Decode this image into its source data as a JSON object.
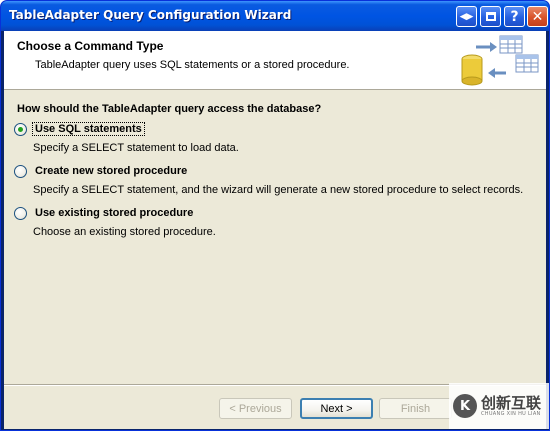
{
  "window": {
    "title": "TableAdapter Query Configuration Wizard",
    "controls": [
      "help-switch-icon",
      "minimize-icon",
      "help-icon",
      "close-icon"
    ]
  },
  "header": {
    "title": "Choose a Command Type",
    "description": "TableAdapter query uses SQL statements or a stored procedure."
  },
  "question": "How should the TableAdapter query access the database?",
  "options": [
    {
      "label": "Use SQL statements",
      "description": "Specify a SELECT statement to load data.",
      "checked": true
    },
    {
      "label": "Create new stored procedure",
      "description": "Specify a SELECT statement, and the wizard will generate a new stored procedure to select records.",
      "checked": false
    },
    {
      "label": "Use existing stored procedure",
      "description": "Choose an existing stored procedure.",
      "checked": false
    }
  ],
  "buttons": {
    "previous": "< Previous",
    "next": "Next >",
    "finish": "Finish"
  },
  "watermark": {
    "logo_text": "K",
    "text": "创新互联",
    "subtext": "CHUANG XIN HU LIAN"
  },
  "colors": {
    "titlebar": "#0054e3",
    "dialog_bg": "#ece9d8",
    "radio_dot": "#21a121"
  }
}
